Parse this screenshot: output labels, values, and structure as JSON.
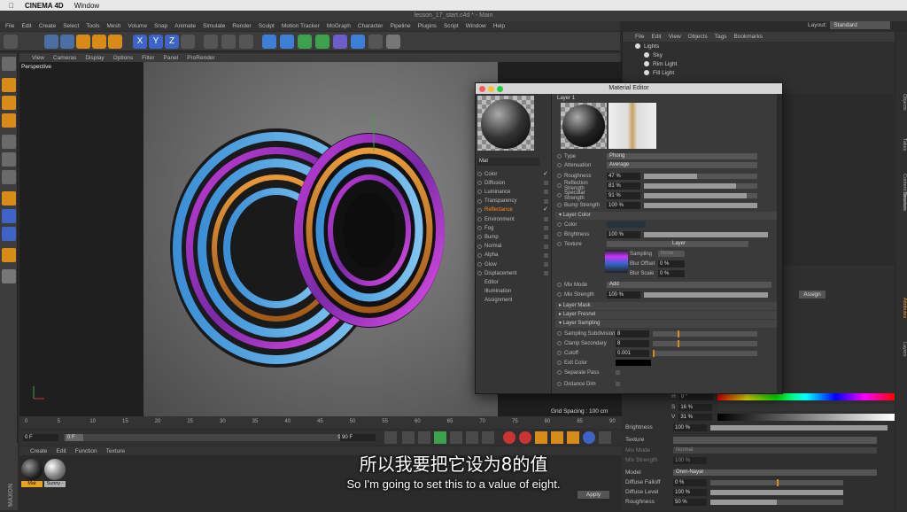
{
  "mac_menu": {
    "app": "CINEMA 4D",
    "window": "Window"
  },
  "window_title": "lesson_17_start.c4d * - Main",
  "c4d_menu": [
    "File",
    "Edit",
    "Create",
    "Select",
    "Tools",
    "Mesh",
    "Volume",
    "Snap",
    "Animate",
    "Simulate",
    "Render",
    "Sculpt",
    "Motion Tracker",
    "MoGraph",
    "Character",
    "Pipeline",
    "Plugins",
    "Script",
    "Window",
    "Help"
  ],
  "layout": {
    "label": "Layout:",
    "value": "Standard"
  },
  "viewport_menu": [
    "View",
    "Cameras",
    "Display",
    "Options",
    "Filter",
    "Panel",
    "ProRender"
  ],
  "viewport_label": "Perspective",
  "grid_spacing": "Grid Spacing : 100 cm",
  "timeline_ticks": [
    "0",
    "5",
    "10",
    "15",
    "20",
    "25",
    "30",
    "35",
    "40",
    "45",
    "50",
    "55",
    "60",
    "65",
    "70",
    "75",
    "80",
    "85",
    "90"
  ],
  "transport": {
    "start": "0 F",
    "current": "0 F",
    "end1": "90 F",
    "end2": "90 F",
    "end_short": "90"
  },
  "materials_menu": [
    "Create",
    "Edit",
    "Function",
    "Texture"
  ],
  "materials": [
    {
      "name": "Mat",
      "color": "#e8a21c"
    },
    {
      "name": "Sunny -",
      "color": "#b0b0b0"
    }
  ],
  "objects_menu": [
    "File",
    "Edit",
    "View",
    "Objects",
    "Tags",
    "Bookmarks"
  ],
  "objects": [
    "Lights",
    "Sky",
    "Rim Light",
    "Fill Light"
  ],
  "right_tabs": [
    "Objects",
    "Takes",
    "Content Browser",
    "Structure",
    "Attributes",
    "Layers"
  ],
  "attr_right": {
    "assign": "Assign",
    "h_label": "H",
    "h_val": "0 °",
    "s_label": "S",
    "s_val": "16 %",
    "v_label": "V",
    "v_val": "31 %",
    "brightness_label": "Brightness",
    "brightness_val": "100 %",
    "texture_label": "Texture",
    "mix_mode_label": "Mix Mode",
    "mix_mode_val": "Normal",
    "mix_strength_label": "Mix Strength",
    "mix_strength_val": "100 %",
    "model_label": "Model",
    "model_val": "Oren-Nayar",
    "diffuse_falloff_label": "Diffuse Falloff",
    "diffuse_falloff_val": "0 %",
    "diffuse_level_label": "Diffuse Level",
    "diffuse_level_val": "100 %",
    "roughness_label": "Roughness",
    "roughness_val": "50 %",
    "apply": "Apply"
  },
  "material_editor": {
    "title": "Material Editor",
    "layer_title": "Layer 1",
    "mat_name": "Mat",
    "channels": [
      {
        "name": "Color",
        "checked": true
      },
      {
        "name": "Diffusion",
        "checked": false
      },
      {
        "name": "Luminance",
        "checked": false
      },
      {
        "name": "Transparency",
        "checked": false
      },
      {
        "name": "Reflectance",
        "checked": true,
        "active": true
      },
      {
        "name": "Environment",
        "checked": false
      },
      {
        "name": "Fog",
        "checked": false
      },
      {
        "name": "Bump",
        "checked": false
      },
      {
        "name": "Normal",
        "checked": false
      },
      {
        "name": "Alpha",
        "checked": false
      },
      {
        "name": "Glow",
        "checked": false
      },
      {
        "name": "Displacement",
        "checked": false
      },
      {
        "name": "Editor"
      },
      {
        "name": "Illumination"
      },
      {
        "name": "Assignment"
      }
    ],
    "type_label": "Type",
    "type_val": "Phong",
    "attenuation_label": "Attenuation",
    "attenuation_val": "Average",
    "roughness_label": "Roughness",
    "roughness_val": "47 %",
    "roughness_frac": 0.47,
    "refl_strength_label": "Reflection Strength",
    "refl_strength_val": "81 %",
    "refl_strength_frac": 0.81,
    "spec_strength_label": "Specular Strength",
    "spec_strength_val": "91 %",
    "spec_strength_frac": 0.91,
    "bump_strength_label": "Bump Strength",
    "bump_strength_val": "100 %",
    "bump_strength_frac": 1.0,
    "layer_color_section": "Layer Color",
    "color_label": "Color",
    "brightness_label": "Brightness",
    "brightness_val": "100 %",
    "texture_label": "Texture",
    "texture_layer": "Layer",
    "sampling_label": "Sampling",
    "sampling_val": "None",
    "blur_offset_label": "Blur Offset",
    "blur_offset_val": "0 %",
    "blur_scale_label": "Blur Scale",
    "blur_scale_val": "0 %",
    "mix_mode_label": "Mix Mode",
    "mix_mode_val": "Add",
    "mix_strength_label": "Mix Strength",
    "mix_strength_val": "100 %",
    "layer_mask_section": "Layer Mask",
    "layer_fresnel_section": "Layer Fresnel",
    "layer_sampling_section": "Layer Sampling",
    "sampling_subdiv_label": "Sampling Subdivision",
    "sampling_subdiv_val": "8",
    "clamp_secondary_label": "Clamp Secondary",
    "clamp_secondary_val": "8",
    "cutoff_label": "Cutoff",
    "cutoff_val": "0.001",
    "exit_color_label": "Exit Color",
    "separate_pass_label": "Separate Pass",
    "distance_dim_label": "Distance Dim"
  },
  "subtitles": {
    "zh": "所以我要把它设为8的值",
    "en": "So I'm going to set this to a value of eight."
  }
}
